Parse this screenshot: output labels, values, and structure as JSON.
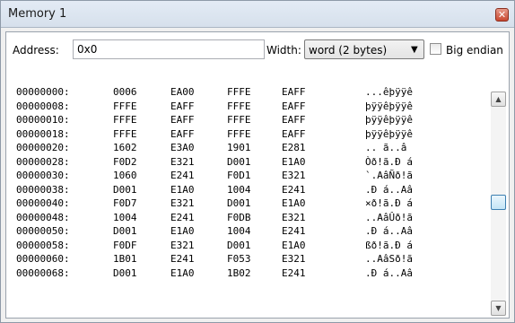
{
  "window": {
    "title": "Memory 1",
    "close_icon": "close-icon"
  },
  "toolbar": {
    "address_label": "Address:",
    "address_value": "0x0",
    "width_label": "Width:",
    "width_selected": "word (2 bytes)",
    "big_endian_label": "Big endian",
    "big_endian_checked": false
  },
  "memory": {
    "rows": [
      {
        "addr": "00000000:",
        "w": [
          "0006",
          "EA00",
          "FFFE",
          "EAFF"
        ],
        "ascii": "...êþÿÿê"
      },
      {
        "addr": "00000008:",
        "w": [
          "FFFE",
          "EAFF",
          "FFFE",
          "EAFF"
        ],
        "ascii": "þÿÿêþÿÿê"
      },
      {
        "addr": "00000010:",
        "w": [
          "FFFE",
          "EAFF",
          "FFFE",
          "EAFF"
        ],
        "ascii": "þÿÿêþÿÿê"
      },
      {
        "addr": "00000018:",
        "w": [
          "FFFE",
          "EAFF",
          "FFFE",
          "EAFF"
        ],
        "ascii": "þÿÿêþÿÿê"
      },
      {
        "addr": "00000020:",
        "w": [
          "1602",
          "E3A0",
          "1901",
          "E281"
        ],
        "ascii": ".. ã..â"
      },
      {
        "addr": "00000028:",
        "w": [
          "F0D2",
          "E321",
          "D001",
          "E1A0"
        ],
        "ascii": "Òð!ã.Ð á"
      },
      {
        "addr": "00000030:",
        "w": [
          "1060",
          "E241",
          "F0D1",
          "E321"
        ],
        "ascii": "`.AâÑð!ã"
      },
      {
        "addr": "00000038:",
        "w": [
          "D001",
          "E1A0",
          "1004",
          "E241"
        ],
        "ascii": ".Ð á..Aâ"
      },
      {
        "addr": "00000040:",
        "w": [
          "F0D7",
          "E321",
          "D001",
          "E1A0"
        ],
        "ascii": "×ð!ã.Ð á"
      },
      {
        "addr": "00000048:",
        "w": [
          "1004",
          "E241",
          "F0DB",
          "E321"
        ],
        "ascii": "..AâÛð!ã"
      },
      {
        "addr": "00000050:",
        "w": [
          "D001",
          "E1A0",
          "1004",
          "E241"
        ],
        "ascii": ".Ð á..Aâ"
      },
      {
        "addr": "00000058:",
        "w": [
          "F0DF",
          "E321",
          "D001",
          "E1A0"
        ],
        "ascii": "ßð!ã.Ð á"
      },
      {
        "addr": "00000060:",
        "w": [
          "1B01",
          "E241",
          "F053",
          "E321"
        ],
        "ascii": "..AâSð!ã"
      },
      {
        "addr": "00000068:",
        "w": [
          "D001",
          "E1A0",
          "1B02",
          "E241"
        ],
        "ascii": ".Ð á..Aâ"
      }
    ]
  },
  "scrollbar": {
    "up_icon": "scroll-up-icon",
    "down_icon": "scroll-down-icon",
    "position_fraction": 0.5
  }
}
